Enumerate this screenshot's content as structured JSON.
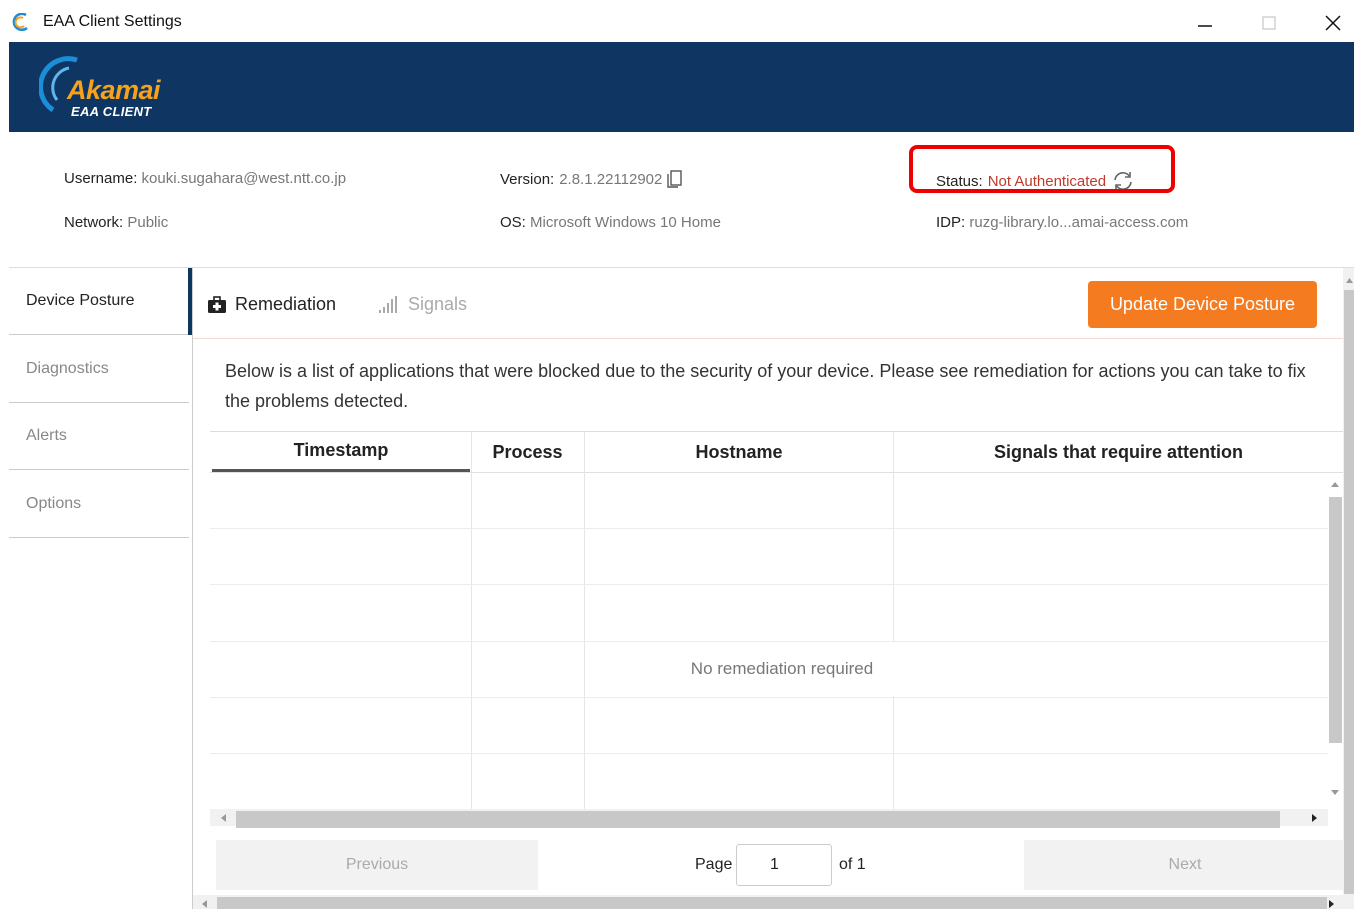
{
  "window": {
    "title": "EAA Client Settings",
    "icon": "akamai-icon"
  },
  "brand": {
    "name": "Akamai",
    "subtitle": "EAA CLIENT",
    "banner_color": "#0f3562",
    "accent": "#f7a21b"
  },
  "info": {
    "username_label": "Username:",
    "username": "kouki.sugahara@west.ntt.co.jp",
    "version_label": "Version:",
    "version": "2.8.1.22112902",
    "status_label": "Status:",
    "status": "Not Authenticated",
    "network_label": "Network:",
    "network": "Public",
    "os_label": "OS:",
    "os": "Microsoft Windows 10 Home",
    "idp_label": "IDP:",
    "idp": "ruzg-library.lo...amai-access.com",
    "status_color": "#c0392b"
  },
  "sidebar": {
    "items": [
      {
        "label": "Device Posture",
        "active": true
      },
      {
        "label": "Diagnostics",
        "active": false
      },
      {
        "label": "Alerts",
        "active": false
      },
      {
        "label": "Options",
        "active": false
      }
    ]
  },
  "tabs": [
    {
      "label": "Remediation",
      "icon": "medkit-icon",
      "active": true
    },
    {
      "label": "Signals",
      "icon": "signal-bars-icon",
      "active": false
    }
  ],
  "update_button": {
    "label": "Update Device Posture",
    "color": "#f47b20"
  },
  "description": "Below is a list of applications that were blocked due to the security of your device. Please see remediation for actions you can take to fix the problems detected.",
  "table": {
    "columns": [
      "Timestamp",
      "Process",
      "Hostname",
      "Signals that require attention"
    ],
    "empty_message": "No remediation required"
  },
  "pager": {
    "previous": "Previous",
    "page_label": "Page",
    "page_value": "1",
    "of_label": "of 1",
    "next": "Next"
  }
}
